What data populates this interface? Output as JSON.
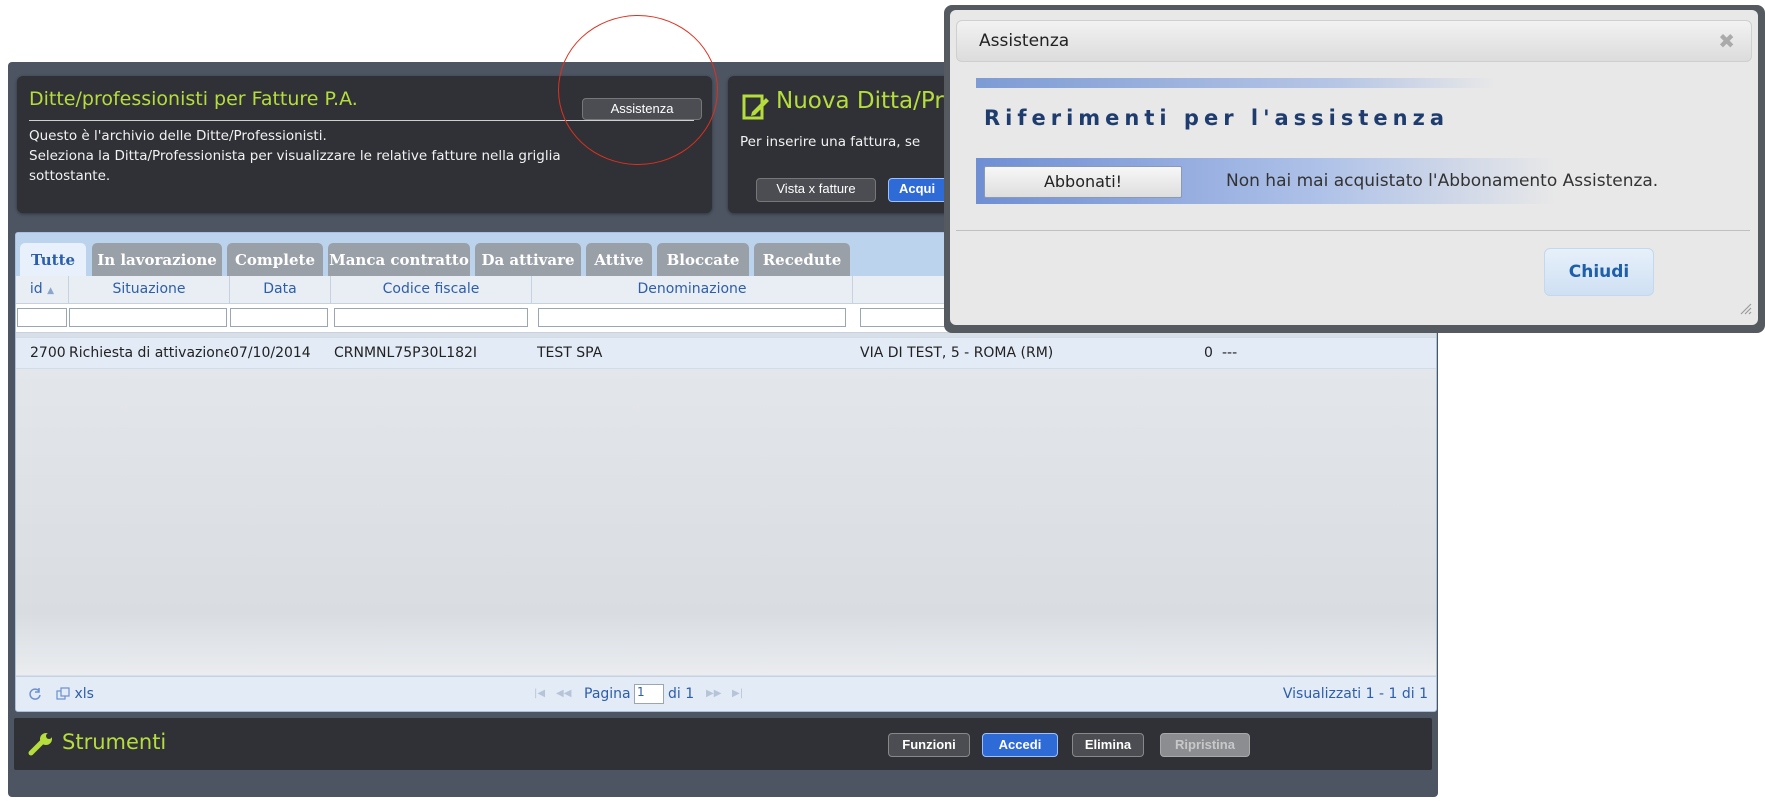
{
  "left_panel": {
    "title": "Ditte/professionisti per Fatture P.A.",
    "assist_button": "Assistenza",
    "line1": "Questo è l'archivio delle Ditte/Professionisti.",
    "line2": "Seleziona la Ditta/Professionista per visualizzare le relative fatture nella griglia",
    "line3": "sottostante."
  },
  "right_panel": {
    "title": "Nuova Ditta/Pr",
    "text": "Per inserire una fattura, se",
    "vista_button": "Vista x fatture",
    "acqui_button": "Acqui"
  },
  "tabs": [
    "Tutte",
    "In lavorazione",
    "Complete",
    "Manca contratto",
    "Da attivare",
    "Attive",
    "Bloccate",
    "Recedute"
  ],
  "columns": {
    "id": "id",
    "sort_icon": "▲",
    "situazione": "Situazione",
    "data": "Data",
    "codice": "Codice fiscale",
    "denominazione": "Denominazione"
  },
  "row": {
    "id": "2700",
    "situazione": "Richiesta di attivazione",
    "data": "07/10/2014",
    "codice": "CRNMNL75P30L182I",
    "denominazione": "TEST SPA",
    "indirizzo": "VIA DI TEST, 5 - ROMA (RM)",
    "count": "0",
    "more": "---"
  },
  "pager": {
    "refresh_icon": "refresh-icon",
    "export_label": "xls",
    "pagina_label": "Pagina",
    "page_value": "1",
    "di_label": "di 1",
    "summary": "Visualizzati 1 - 1 di 1"
  },
  "tools": {
    "title": "Strumenti",
    "buttons": [
      "Funzioni",
      "Accedi",
      "Elimina",
      "Ripristina"
    ]
  },
  "dialog": {
    "title": "Assistenza",
    "close": "✖",
    "heading": "Riferimenti per l'assistenza",
    "abbonati_button": "Abbonati!",
    "message": "Non hai mai acquistato l'Abbonamento Assistenza.",
    "chiudi_button": "Chiudi"
  },
  "colors": {
    "accent_green": "#b5dd3c",
    "panel_dark": "#2f3136",
    "link_blue": "#2d5ea8",
    "annotation_red": "#e0301e"
  }
}
